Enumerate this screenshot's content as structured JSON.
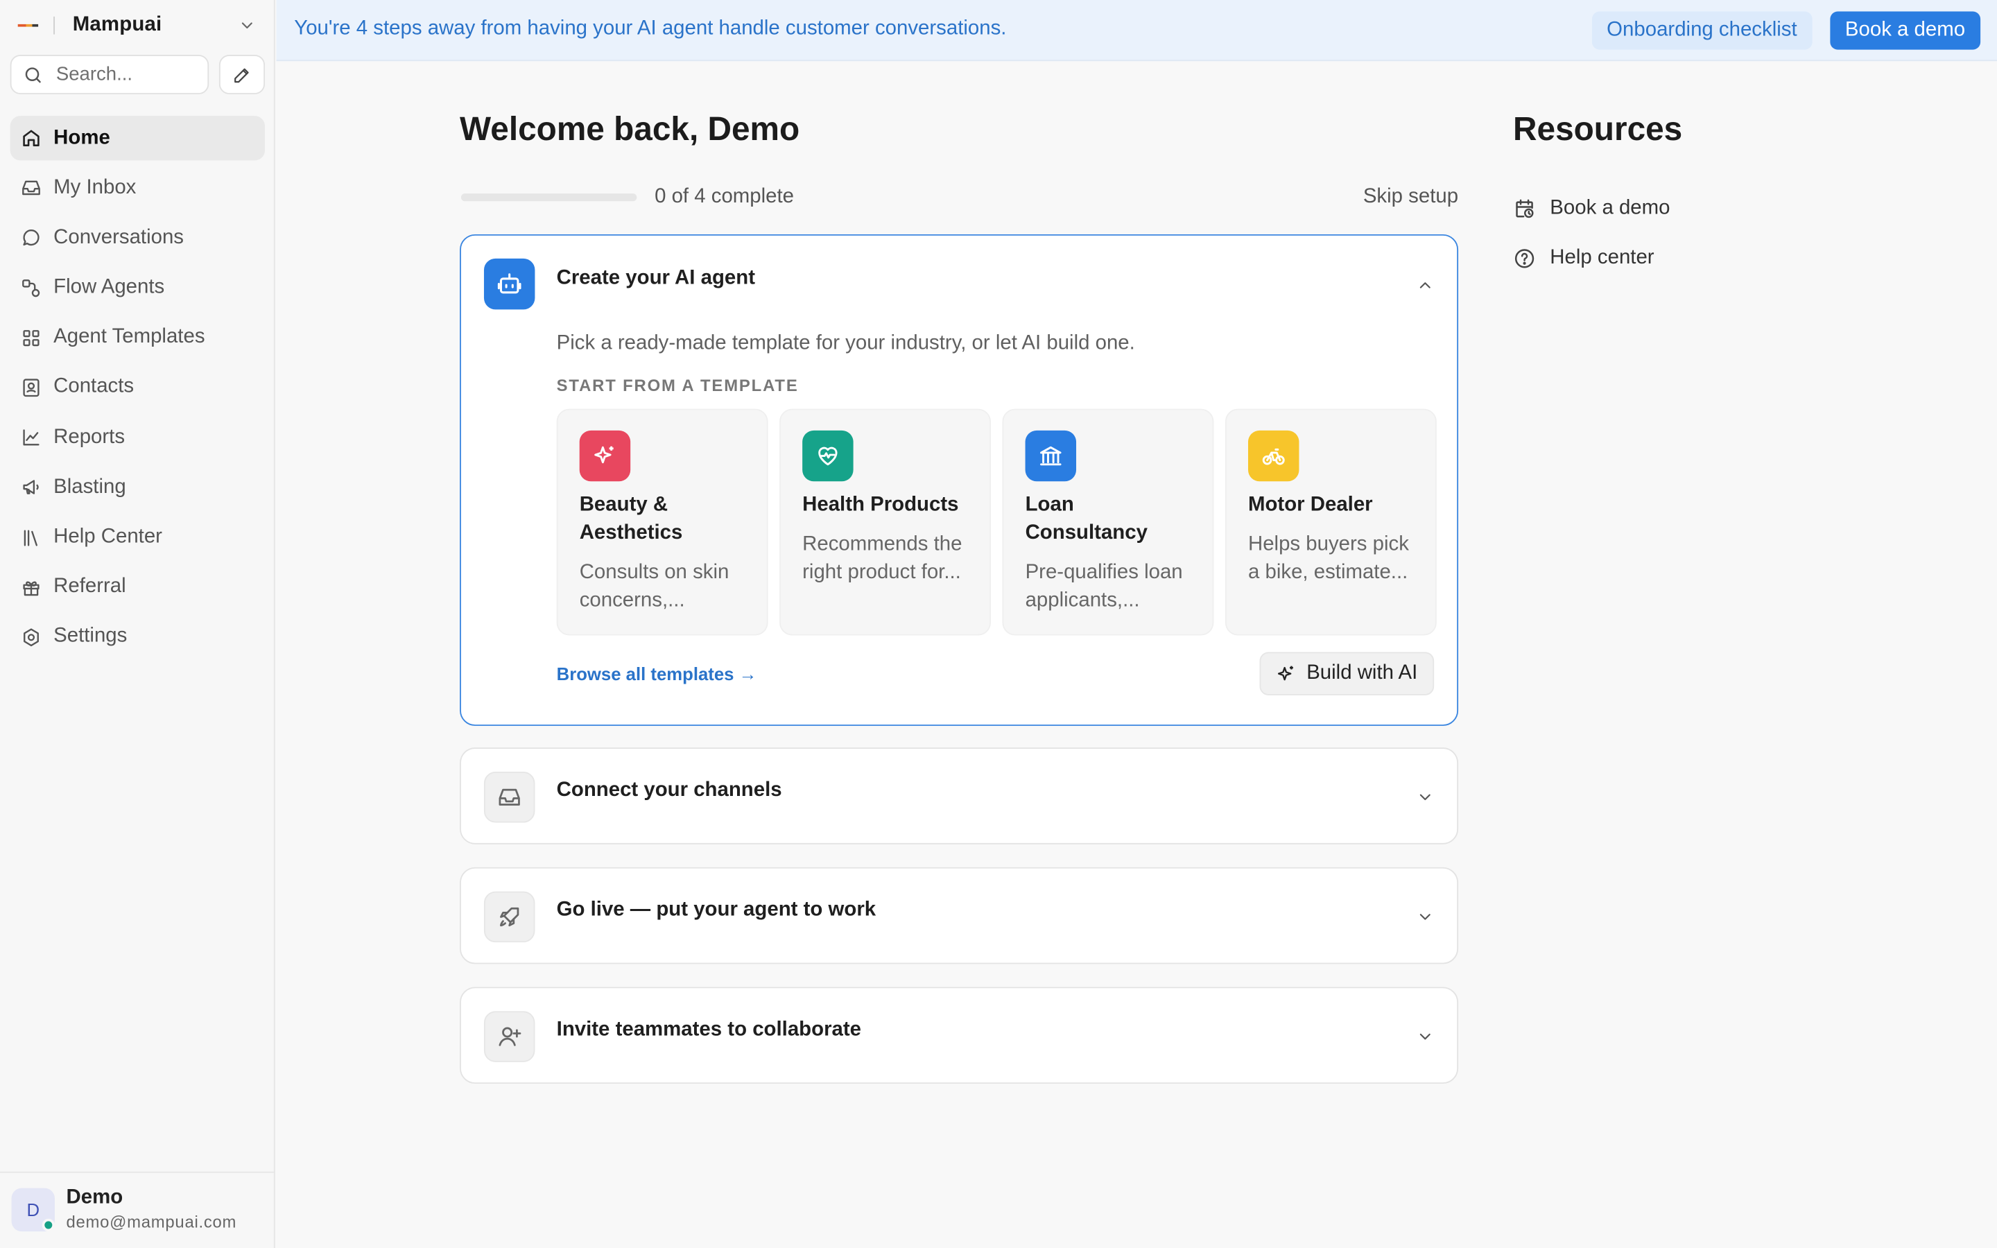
{
  "workspace": {
    "name": "Mampuai"
  },
  "search": {
    "placeholder": "Search..."
  },
  "nav": [
    {
      "label": "Home",
      "icon": "home-icon",
      "active": true
    },
    {
      "label": "My Inbox",
      "icon": "inbox-icon"
    },
    {
      "label": "Conversations",
      "icon": "chat-bubble-icon"
    },
    {
      "label": "Flow Agents",
      "icon": "flow-icon"
    },
    {
      "label": "Agent Templates",
      "icon": "grid-icon"
    },
    {
      "label": "Contacts",
      "icon": "contact-card-icon"
    },
    {
      "label": "Reports",
      "icon": "line-chart-icon"
    },
    {
      "label": "Blasting",
      "icon": "megaphone-icon"
    },
    {
      "label": "Help Center",
      "icon": "library-icon"
    },
    {
      "label": "Referral",
      "icon": "gift-icon"
    },
    {
      "label": "Settings",
      "icon": "gear-icon"
    }
  ],
  "user": {
    "initial": "D",
    "name": "Demo",
    "email": "demo@mampuai.com",
    "status_color": "#16a085"
  },
  "banner": {
    "text": "You're 4 steps away from having your AI agent handle customer conversations.",
    "checklist_label": "Onboarding checklist",
    "demo_label": "Book a demo"
  },
  "main": {
    "title": "Welcome back, Demo",
    "progress": {
      "completed": 0,
      "total": 4,
      "text": "0 of 4 complete"
    },
    "skip_label": "Skip setup",
    "steps": [
      {
        "title": "Create your AI agent",
        "expanded": true,
        "description": "Pick a ready-made template for your industry, or let AI build one.",
        "templates_heading": "START FROM A TEMPLATE",
        "templates": [
          {
            "name": "Beauty & Aesthetics",
            "desc": "Consults on skin concerns,...",
            "color": "#e8475f",
            "icon": "sparkles-icon"
          },
          {
            "name": "Health Products",
            "desc": "Recommends the right product for...",
            "color": "#16a38a",
            "icon": "heart-pulse-icon"
          },
          {
            "name": "Loan Consultancy",
            "desc": "Pre-qualifies loan applicants,...",
            "color": "#2a7de1",
            "icon": "bank-icon"
          },
          {
            "name": "Motor Dealer",
            "desc": "Helps buyers pick a bike, estimate...",
            "color": "#f7c52b",
            "icon": "bike-icon"
          }
        ],
        "browse_label": "Browse all templates →",
        "build_label": "Build with AI"
      },
      {
        "title": "Connect your channels",
        "icon": "inbox-icon"
      },
      {
        "title": "Go live — put your agent to work",
        "icon": "rocket-icon"
      },
      {
        "title": "Invite teammates to collaborate",
        "icon": "user-plus-icon"
      }
    ]
  },
  "resources": {
    "title": "Resources",
    "items": [
      {
        "label": "Book a demo",
        "icon": "calendar-clock-icon"
      },
      {
        "label": "Help center",
        "icon": "help-circle-icon"
      }
    ]
  },
  "colors": {
    "accent": "#2a7de1",
    "banner_bg": "#eaf2fc",
    "banner_text": "#2a73c9"
  }
}
